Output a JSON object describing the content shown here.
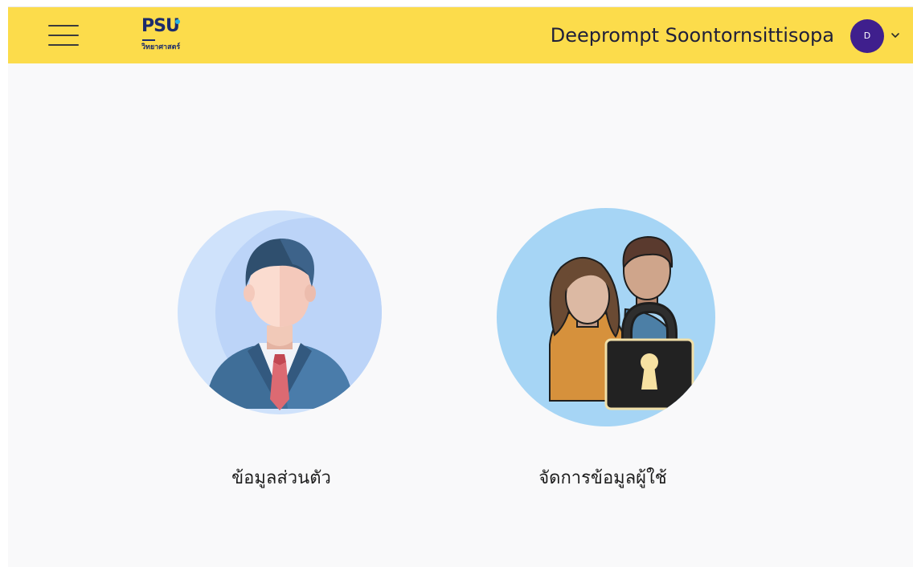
{
  "header": {
    "logo": {
      "mark": "PSU",
      "subtitle": "วิทยาศาสตร์"
    },
    "user": {
      "name": "Deeprompt Soontornsittisopa",
      "avatar_initial": "D"
    }
  },
  "colors": {
    "header_bg": "#fcdc4b",
    "page_bg": "#f9f9fa",
    "avatar_bg": "#3f1f8d",
    "brand_navy": "#1c2b6b"
  },
  "menu": {
    "items": [
      {
        "label": "ข้อมูลส่วนตัว",
        "icon": "businessman-icon"
      },
      {
        "label": "จัดการข้อมูลผู้ใช้",
        "icon": "users-lock-icon"
      }
    ]
  }
}
